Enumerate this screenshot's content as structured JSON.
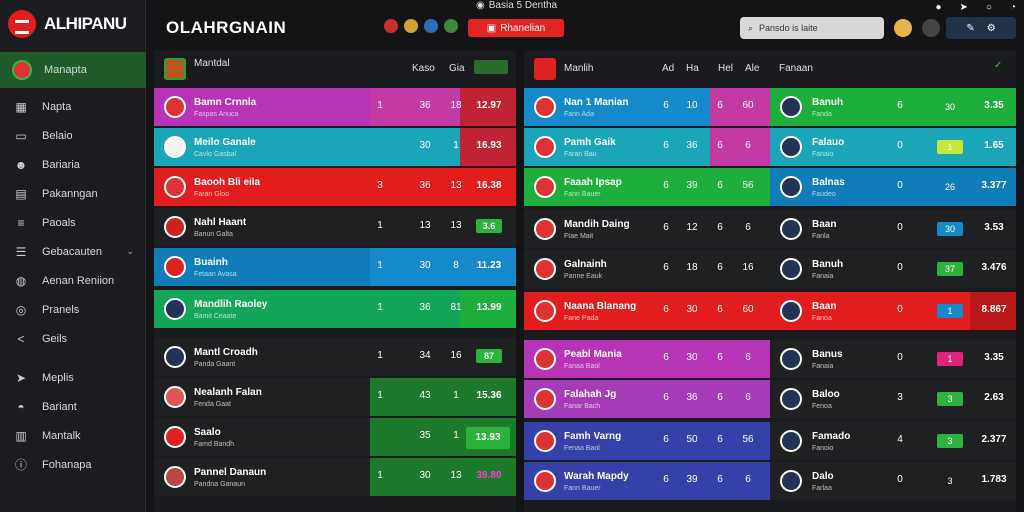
{
  "brand": {
    "name": "ALHIPANU"
  },
  "header": {
    "title": "OLAHRGNAIN",
    "top_tab": "Basia 5 Dentha",
    "live_label": "Rhanelian",
    "search_placeholder": "Pansdo is laite"
  },
  "sidebar": {
    "items": [
      {
        "label": "Manapta",
        "icon": "ball-icon",
        "active": true
      },
      {
        "label": "Napta",
        "icon": "chart-icon"
      },
      {
        "label": "Belaio",
        "icon": "card-icon"
      },
      {
        "label": "Bariaria",
        "icon": "user-icon"
      },
      {
        "label": "Pakanngan",
        "icon": "doc-icon"
      },
      {
        "label": "Paoals",
        "icon": "list-icon"
      },
      {
        "label": "Gebacauten",
        "icon": "stack-icon",
        "chevron": true
      },
      {
        "label": "Aenan Reniion",
        "icon": "globe-icon"
      },
      {
        "label": "Pranels",
        "icon": "target-icon"
      },
      {
        "label": "Geils",
        "icon": "share-icon"
      },
      {
        "label": "Meplis",
        "icon": "send-icon"
      },
      {
        "label": "Bariant",
        "icon": "chat-icon"
      },
      {
        "label": "Mantalk",
        "icon": "table-icon"
      },
      {
        "label": "Fohanapa",
        "icon": "info-icon"
      }
    ]
  },
  "left_panel": {
    "header": {
      "label": "Mantdal",
      "col1": "Kaso",
      "col2": "Gia"
    },
    "rows": [
      {
        "name": "Bamn Crnnla",
        "sub": "Faxpas Anuca",
        "a": "1",
        "b": "36",
        "c": "18",
        "odds": "12.97"
      },
      {
        "name": "Meilo Ganale",
        "sub": "Cavlo Gasbal",
        "a": "",
        "b": "30",
        "c": "1",
        "odds": "16.93"
      },
      {
        "name": "Baooh Bli eila",
        "sub": "Faran Gloo",
        "a": "3",
        "b": "36",
        "c": "13",
        "odds": "16.38"
      },
      {
        "name": "Nahl Haant",
        "sub": "Banun Galta",
        "a": "1",
        "b": "13",
        "c": "13",
        "odds": "3.6"
      },
      {
        "name": "Buainh",
        "sub": "Fetaan Avasa",
        "a": "1",
        "b": "30",
        "c": "8",
        "odds": "11.23"
      },
      {
        "name": "Mandlih Raoley",
        "sub": "Bamit Ceaate",
        "a": "1",
        "b": "36",
        "c": "81",
        "odds": "13.99"
      },
      {
        "name": "Mantl Croadh",
        "sub": "Panda Gaant",
        "a": "1",
        "b": "34",
        "c": "16",
        "odds": "87"
      },
      {
        "name": "Nealanh Falan",
        "sub": "Fenda Gaat",
        "a": "1",
        "b": "43",
        "c": "1",
        "odds": "15.36"
      },
      {
        "name": "Saalo",
        "sub": "Famd Bandh",
        "a": "",
        "b": "35",
        "c": "1",
        "odds": "13.93"
      },
      {
        "name": "Pannel Danaun",
        "sub": "Pandna Ganaun",
        "a": "1",
        "b": "30",
        "c": "13",
        "odds": "39.80"
      }
    ]
  },
  "right_panel": {
    "header": {
      "label": "Manlih",
      "c1": "Ad",
      "c2": "Ha",
      "c3": "Hel",
      "c4": "Ale",
      "r": "Fanaan"
    },
    "rows": [
      {
        "name": "Nan 1 Manian",
        "sub": "Fann Ada",
        "a": "6",
        "b": "10",
        "c": "6",
        "d": "60",
        "rname": "Banuh",
        "rsub": "Fanda",
        "rv": "6",
        "rp": "30",
        "rodds": "3.35"
      },
      {
        "name": "Pamh Gaik",
        "sub": "Faran Bau",
        "a": "6",
        "b": "36",
        "c": "6",
        "d": "6",
        "rname": "Falauo",
        "rsub": "Fanaio",
        "rv": "0",
        "rp": "1",
        "rodds": "1.65"
      },
      {
        "name": "Faaah Ipsap",
        "sub": "Fann Bauer",
        "a": "6",
        "b": "39",
        "c": "6",
        "d": "56",
        "rname": "Balnas",
        "rsub": "Faudeo",
        "rv": "0",
        "rp": "26",
        "rodds": "3.377"
      },
      {
        "name": "Mandih Daing",
        "sub": "Ftae Mait",
        "a": "6",
        "b": "12",
        "c": "6",
        "d": "6",
        "rname": "Baan",
        "rsub": "Fanla",
        "rv": "0",
        "rp": "30",
        "rodds": "3.53"
      },
      {
        "name": "Galnainh",
        "sub": "Panne Eauk",
        "a": "6",
        "b": "18",
        "c": "6",
        "d": "16",
        "rname": "Banuh",
        "rsub": "Fanaia",
        "rv": "0",
        "rp": "37",
        "rodds": "3.476"
      },
      {
        "name": "Naana Blanang",
        "sub": "Fane Pada",
        "a": "6",
        "b": "30",
        "c": "6",
        "d": "60",
        "rname": "Baan",
        "rsub": "Fanoa",
        "rv": "0",
        "rp": "1",
        "rodds": "8.867"
      },
      {
        "name": "Peabl Mania",
        "sub": "Fanaa Baol",
        "a": "6",
        "b": "30",
        "c": "6",
        "d": "6",
        "rname": "Banus",
        "rsub": "Fanaia",
        "rv": "0",
        "rp": "1",
        "rodds": "3.35"
      },
      {
        "name": "Falahah Jg",
        "sub": "Fanar Bach",
        "a": "6",
        "b": "36",
        "c": "6",
        "d": "6",
        "rname": "Baloo",
        "rsub": "Fenoa",
        "rv": "3",
        "rp": "3",
        "rodds": "2.63"
      },
      {
        "name": "Famh Varng",
        "sub": "Fenaa Baol",
        "a": "6",
        "b": "50",
        "c": "6",
        "d": "56",
        "rname": "Famado",
        "rsub": "Fanoio",
        "rv": "4",
        "rp": "3",
        "rodds": "2.377"
      },
      {
        "name": "Warah Mapdy",
        "sub": "Fann Bauer",
        "a": "6",
        "b": "39",
        "c": "6",
        "d": "6",
        "rname": "Dalo",
        "rsub": "Farlaa",
        "rv": "0",
        "rp": "3",
        "rodds": "1.783"
      }
    ]
  }
}
